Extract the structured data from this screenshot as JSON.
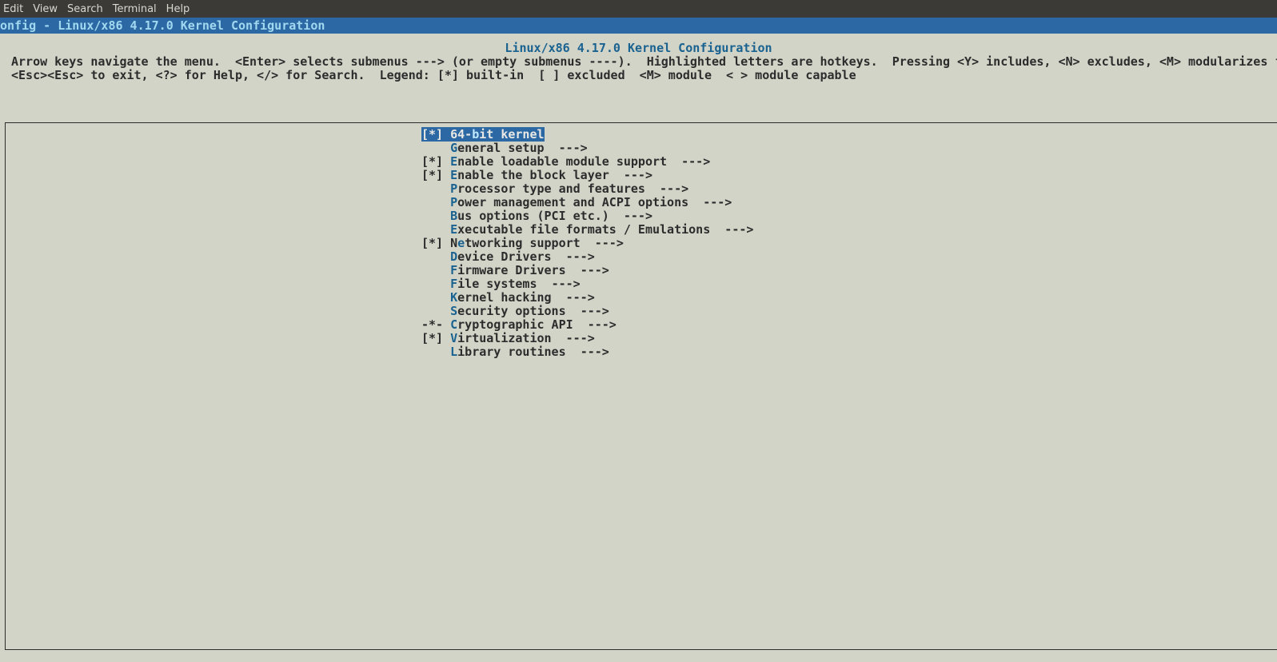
{
  "menubar": {
    "items": [
      "Edit",
      "View",
      "Search",
      "Terminal",
      "Help"
    ]
  },
  "titlebar": "onfig - Linux/x86 4.17.0 Kernel Configuration",
  "heading": "Linux/x86 4.17.0 Kernel Configuration",
  "instructions_line1": "Arrow keys navigate the menu.  <Enter> selects submenus ---> (or empty submenus ----).  Highlighted letters are hotkeys.  Pressing <Y> includes, <N> excludes, <M> modularizes f",
  "instructions_line2": "<Esc><Esc> to exit, <?> for Help, </> for Search.  Legend: [*] built-in  [ ] excluded  <M> module  < > module capable",
  "menu": {
    "items": [
      {
        "prefix": "[*] ",
        "pre": "64-",
        "hot": "b",
        "post": "it kernel",
        "arrow": "",
        "selected": true
      },
      {
        "prefix": "    ",
        "pre": "",
        "hot": "G",
        "post": "eneral setup  ",
        "arrow": "--->",
        "selected": false
      },
      {
        "prefix": "[*] ",
        "pre": "",
        "hot": "E",
        "post": "nable loadable module support  ",
        "arrow": "--->",
        "selected": false
      },
      {
        "prefix": "[*] ",
        "pre": "",
        "hot": "E",
        "post": "nable the block layer  ",
        "arrow": "--->",
        "selected": false
      },
      {
        "prefix": "    ",
        "pre": "",
        "hot": "P",
        "post": "rocessor type and features  ",
        "arrow": "--->",
        "selected": false
      },
      {
        "prefix": "    ",
        "pre": "",
        "hot": "P",
        "post": "ower management and ACPI options  ",
        "arrow": "--->",
        "selected": false
      },
      {
        "prefix": "    ",
        "pre": "",
        "hot": "B",
        "post": "us options (PCI etc.)  ",
        "arrow": "--->",
        "selected": false
      },
      {
        "prefix": "    ",
        "pre": "",
        "hot": "E",
        "post": "xecutable file formats / Emulations  ",
        "arrow": "--->",
        "selected": false
      },
      {
        "prefix": "[*] ",
        "pre": "N",
        "hot": "e",
        "post": "tworking support  ",
        "arrow": "--->",
        "selected": false
      },
      {
        "prefix": "    ",
        "pre": "",
        "hot": "D",
        "post": "evice Drivers  ",
        "arrow": "--->",
        "selected": false
      },
      {
        "prefix": "    ",
        "pre": "",
        "hot": "F",
        "post": "irmware Drivers  ",
        "arrow": "--->",
        "selected": false
      },
      {
        "prefix": "    ",
        "pre": "",
        "hot": "F",
        "post": "ile systems  ",
        "arrow": "--->",
        "selected": false
      },
      {
        "prefix": "    ",
        "pre": "",
        "hot": "K",
        "post": "ernel hacking  ",
        "arrow": "--->",
        "selected": false
      },
      {
        "prefix": "    ",
        "pre": "",
        "hot": "S",
        "post": "ecurity options  ",
        "arrow": "--->",
        "selected": false
      },
      {
        "prefix": "-*- ",
        "pre": "",
        "hot": "C",
        "post": "ryptographic API  ",
        "arrow": "--->",
        "selected": false
      },
      {
        "prefix": "[*] ",
        "pre": "",
        "hot": "V",
        "post": "irtualization  ",
        "arrow": "--->",
        "selected": false
      },
      {
        "prefix": "    ",
        "pre": "",
        "hot": "L",
        "post": "ibrary routines  ",
        "arrow": "--->",
        "selected": false
      }
    ]
  }
}
